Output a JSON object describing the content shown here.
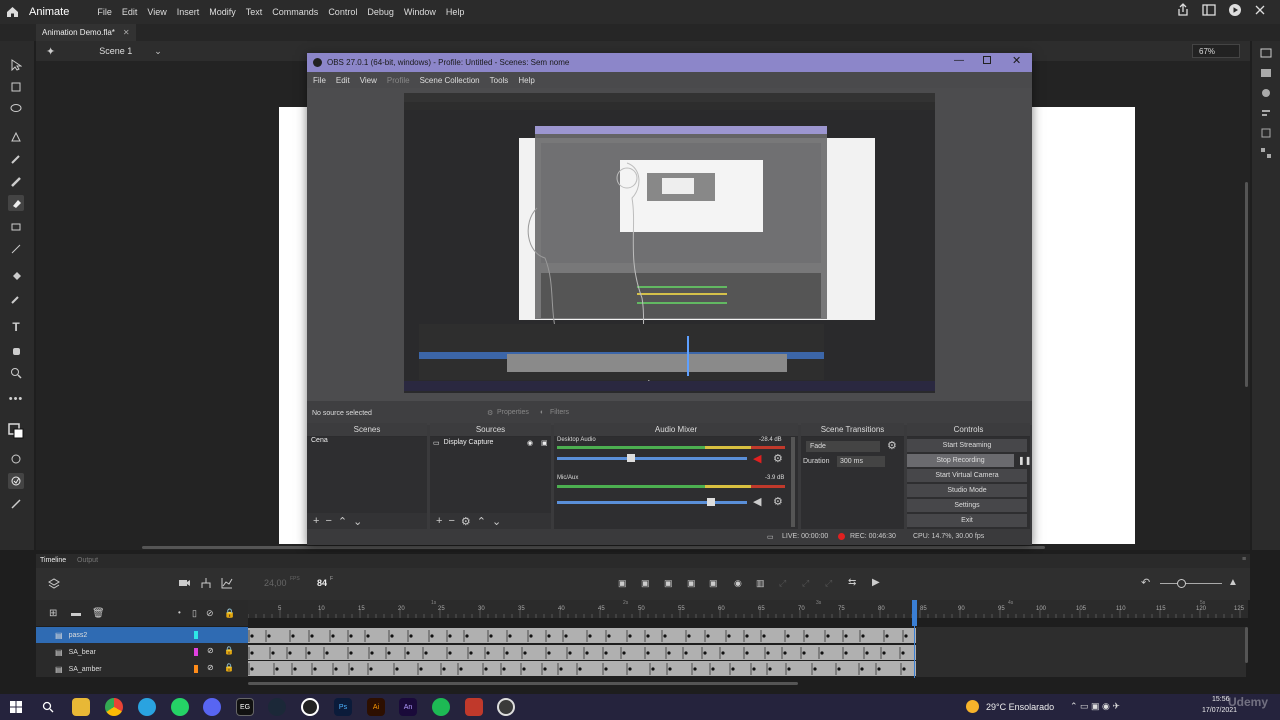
{
  "app": {
    "name": "Animate",
    "menu": [
      "File",
      "Edit",
      "View",
      "Insert",
      "Modify",
      "Text",
      "Commands",
      "Control",
      "Debug",
      "Window",
      "Help"
    ]
  },
  "document": {
    "tab_title": "Animation Demo.fla*",
    "scene": "Scene 1",
    "zoom": "67%"
  },
  "obs": {
    "title": "OBS 27.0.1 (64-bit, windows) - Profile: Untitled - Scenes: Sem nome",
    "menu": [
      "File",
      "Edit",
      "View",
      "Profile",
      "Scene Collection",
      "Tools",
      "Help"
    ],
    "no_source": "No source selected",
    "properties": "Properties",
    "filters": "Filters",
    "docks": {
      "scenes": "Scenes",
      "sources": "Sources",
      "audio_mixer": "Audio Mixer",
      "scene_transitions": "Scene Transitions",
      "controls": "Controls"
    },
    "scene_item": "Cena",
    "source_item": "Display Capture",
    "audio": [
      {
        "name": "Desktop Audio",
        "db": "-28.4 dB",
        "level": 0.45
      },
      {
        "name": "Mic/Aux",
        "db": "-3.9 dB",
        "level": 0.8
      }
    ],
    "transition": "Fade",
    "duration_label": "Duration",
    "duration_value": "300 ms",
    "controls": [
      "Start Streaming",
      "Stop Recording",
      "Start Virtual Camera",
      "Studio Mode",
      "Settings",
      "Exit"
    ],
    "status": {
      "live": "LIVE: 00:00:00",
      "rec": "REC: 00:46:30",
      "cpu": "CPU: 14.7%, 30.00 fps"
    }
  },
  "timeline": {
    "tabs": [
      "Timeline",
      "Output"
    ],
    "fps": "24,00",
    "fps_unit": "FPS",
    "frame": "84",
    "frame_unit": "F",
    "ruler": [
      "5",
      "10",
      "15",
      "20",
      "25",
      "30",
      "35",
      "40",
      "45",
      "50",
      "55",
      "60",
      "65",
      "70",
      "75",
      "80",
      "85",
      "90",
      "95",
      "100",
      "105",
      "110",
      "115",
      "120",
      "125"
    ],
    "seconds": [
      "1s",
      "2s",
      "3s",
      "4s",
      "5s"
    ],
    "layers": [
      {
        "name": "pass2",
        "color": "#2ee6e6"
      },
      {
        "name": "SA_bear",
        "color": "#e040e0"
      },
      {
        "name": "SA_amber",
        "color": "#ff8c1a"
      }
    ]
  },
  "taskbar": {
    "apps": [
      "Windows",
      "Search",
      "File Explorer",
      "Chrome",
      "Telegram",
      "WhatsApp",
      "Discord",
      "Epic Games",
      "Steam",
      "Spotify Outline",
      "Ps",
      "Ai",
      "An",
      "Spotify",
      "Media",
      "OBS"
    ],
    "weather": "29°C  Ensolarado",
    "time": "15:56",
    "date": "17/07/2021"
  },
  "watermark": "Udemy",
  "colors": {
    "obs_title": "#8c86c9",
    "selected_layer": "#2f6bb3",
    "playhead": "#3a7fd5",
    "rec_red": "#e02020",
    "meter_green": "#4caf50"
  }
}
